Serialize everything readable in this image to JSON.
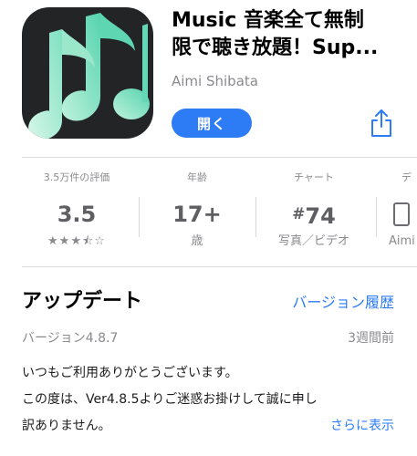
{
  "app": {
    "title_line1": "Music  音楽全て無制",
    "title_line2": "限で聴き放題！Sup...",
    "developer": "Aimi Shibata",
    "get_button_label": "開く",
    "icon_name": "music-notes-icon",
    "icon_colors": {
      "background": "#222426",
      "note_light": "#b9f0d9",
      "note_teal": "#64d8b6"
    }
  },
  "share": {
    "icon_name": "share-icon",
    "color": "#2d7cf6"
  },
  "stats": [
    {
      "label": "3.5万件の評価",
      "value": "3.5",
      "stars": "★★★⯪☆",
      "rating": 3.5
    },
    {
      "label": "年齢",
      "value": "17+",
      "sub": "歳"
    },
    {
      "label": "チャート",
      "hash": "#",
      "value": "74",
      "sub": "写真／ビデオ"
    },
    {
      "label": "デ",
      "value": "",
      "sub": "Aimi"
    }
  ],
  "updates": {
    "title": "アップデート",
    "version_history_link": "バージョン履歴",
    "version": "バージョン4.8.7",
    "date": "3週間前",
    "notes_line1": "いつもご利用ありがとうございます。",
    "notes_line2": "この度は、Ver4.8.5よりご迷惑お掛けして誠に申し",
    "notes_line3": "訳ありません。",
    "more_link": "さらに表示"
  },
  "colors": {
    "accent": "#2d7cf6",
    "secondary_text": "#8a8a8e",
    "divider": "#d9d9dc"
  }
}
